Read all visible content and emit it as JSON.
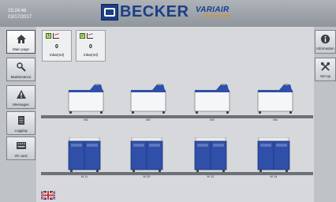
{
  "header": {
    "time": "15:24:46",
    "date": "03/17/2017",
    "brand": "BECKER",
    "product": "VARIAIR"
  },
  "nav_left": [
    {
      "label": "Main page",
      "icon": "home-icon",
      "active": true
    },
    {
      "label": "Maintenance",
      "icon": "tools-icon",
      "active": false
    },
    {
      "label": "Messages",
      "icon": "warning-icon",
      "active": false
    },
    {
      "label": "Logging",
      "icon": "logging-icon",
      "active": false
    },
    {
      "label": "I/O card",
      "icon": "io-card-icon",
      "active": false
    }
  ],
  "nav_right": [
    {
      "label": "Information",
      "icon": "info-icon"
    },
    {
      "label": "Set up",
      "icon": "setup-icon"
    }
  ],
  "panels": [
    {
      "num": "1",
      "value": "0",
      "unit": "mbar(rel)"
    },
    {
      "num": "2",
      "value": "0",
      "unit": "mbar(rel)"
    }
  ],
  "row1": [
    {
      "label": "M1"
    },
    {
      "label": "M2"
    },
    {
      "label": "M3"
    },
    {
      "label": "M4"
    }
  ],
  "row2": [
    {
      "label": "M 11"
    },
    {
      "label": "M 20"
    },
    {
      "label": "M 12"
    },
    {
      "label": "M 14"
    }
  ],
  "colors": {
    "brand_blue": "#1c3e86",
    "machine_blue": "#2f4fa8",
    "status_green": "#b8d86b"
  }
}
